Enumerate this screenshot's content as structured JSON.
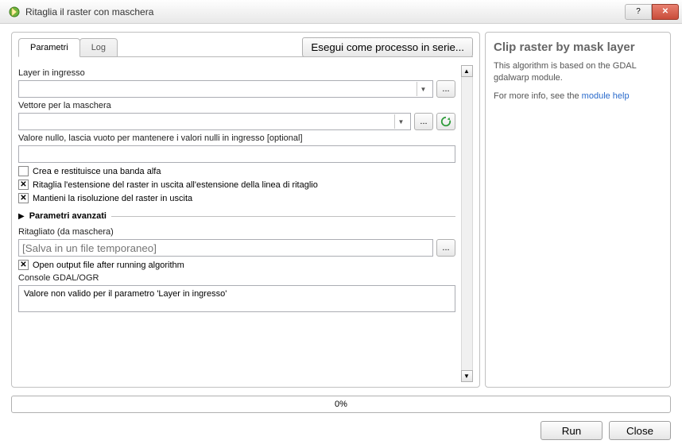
{
  "window": {
    "title": "Ritaglia il raster con maschera"
  },
  "tabs": {
    "parametri": "Parametri",
    "log": "Log"
  },
  "batch_button": "Esegui come processo in serie...",
  "fields": {
    "layer_in": {
      "label": "Layer in ingresso"
    },
    "mask": {
      "label": "Vettore per la maschera"
    },
    "null_value": {
      "label": "Valore nullo, lascia vuoto per mantenere i valori nulli in ingresso [optional]"
    }
  },
  "checks": {
    "alpha": {
      "label": "Crea e restituisce una banda alfa",
      "checked": false
    },
    "extent": {
      "label": "Ritaglia l'estensione del raster in uscita all'estensione della linea di ritaglio",
      "checked": true
    },
    "resolution": {
      "label": "Mantieni la risoluzione del raster in uscita",
      "checked": true
    },
    "open_after": {
      "label": "Open output file after running algorithm",
      "checked": true
    }
  },
  "advanced": {
    "label": "Parametri avanzati"
  },
  "output": {
    "label": "Ritagliato (da maschera)",
    "placeholder": "[Salva in un file temporaneo]"
  },
  "console": {
    "label": "Console GDAL/OGR",
    "text": "Valore non valido per il parametro 'Layer in ingresso'"
  },
  "help": {
    "title": "Clip raster by mask layer",
    "desc": "This algorithm is based on the GDAL gdalwarp module.",
    "more_prefix": "For more info, see the ",
    "more_link": "module help"
  },
  "progress": {
    "text": "0%"
  },
  "buttons": {
    "run": "Run",
    "close": "Close"
  },
  "glyphs": {
    "dots": "...",
    "x": "✕",
    "help": "?",
    "tri_right": "▶",
    "tri_down": "▼",
    "up": "▲",
    "down": "▼"
  }
}
